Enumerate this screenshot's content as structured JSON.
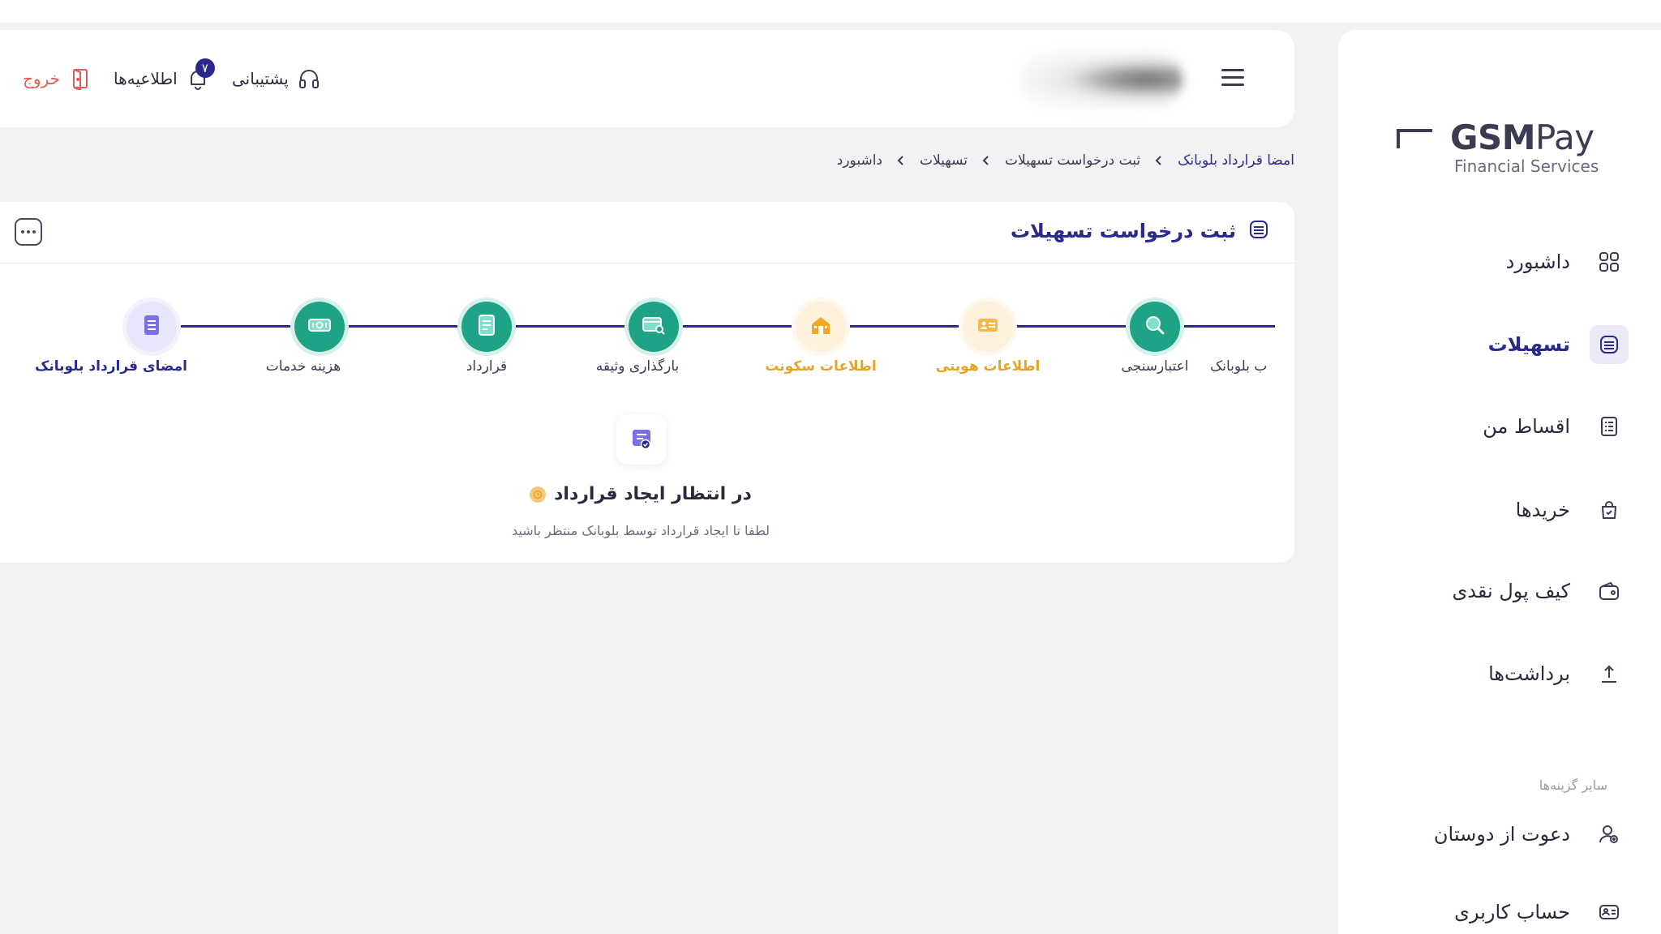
{
  "colors": {
    "primary": "#2a2a8c",
    "success": "#1ea386",
    "warning": "#e6a325",
    "danger": "#e05a5a"
  },
  "logo": {
    "brand_bold": "GSM",
    "brand_light": "Pay",
    "tagline": "Financial Services"
  },
  "sidebar": {
    "items": [
      {
        "label": "داشبورد",
        "icon": "grid-icon"
      },
      {
        "label": "تسهیلات",
        "icon": "card-stack-icon",
        "active": true
      },
      {
        "label": "اقساط من",
        "icon": "list-icon"
      },
      {
        "label": "خریدها",
        "icon": "bag-icon"
      },
      {
        "label": "کیف پول نقدی",
        "icon": "wallet-icon"
      },
      {
        "label": "برداشت‌ها",
        "icon": "upload-icon"
      }
    ],
    "section_title": "سایر گزینه‌ها",
    "other_items": [
      {
        "label": "دعوت از دوستان",
        "icon": "invite-user-icon"
      },
      {
        "label": "حساب کاربری",
        "icon": "id-card-icon"
      }
    ]
  },
  "header": {
    "logout_label": "خروج",
    "notifications_label": "اطلاعیه‌ها",
    "notifications_count": "۷",
    "support_label": "پشتیبانی"
  },
  "breadcrumb": {
    "items": [
      "داشبورد",
      "تسهیلات",
      "ثبت درخواست تسهیلات",
      "امضا قرارداد بلوبانک"
    ]
  },
  "card": {
    "title": "ثبت درخواست تسهیلات",
    "steps": [
      {
        "label": "ب بلوبانک",
        "state": "done"
      },
      {
        "label": "اعتبارسنجی",
        "state": "done"
      },
      {
        "label": "اطلاعات هویتی",
        "state": "warn"
      },
      {
        "label": "اطلاعات سکونت",
        "state": "warn"
      },
      {
        "label": "بارگذاری وثیقه",
        "state": "done"
      },
      {
        "label": "قرارداد",
        "state": "done"
      },
      {
        "label": "هزینه خدمات",
        "state": "done"
      },
      {
        "label": "امضای قرارداد بلوبانک",
        "state": "current"
      }
    ],
    "status": {
      "title": "در انتظار ایجاد قرارداد",
      "description": "لطفا تا ایجاد قرارداد توسط بلوبانک منتظر باشید"
    }
  }
}
